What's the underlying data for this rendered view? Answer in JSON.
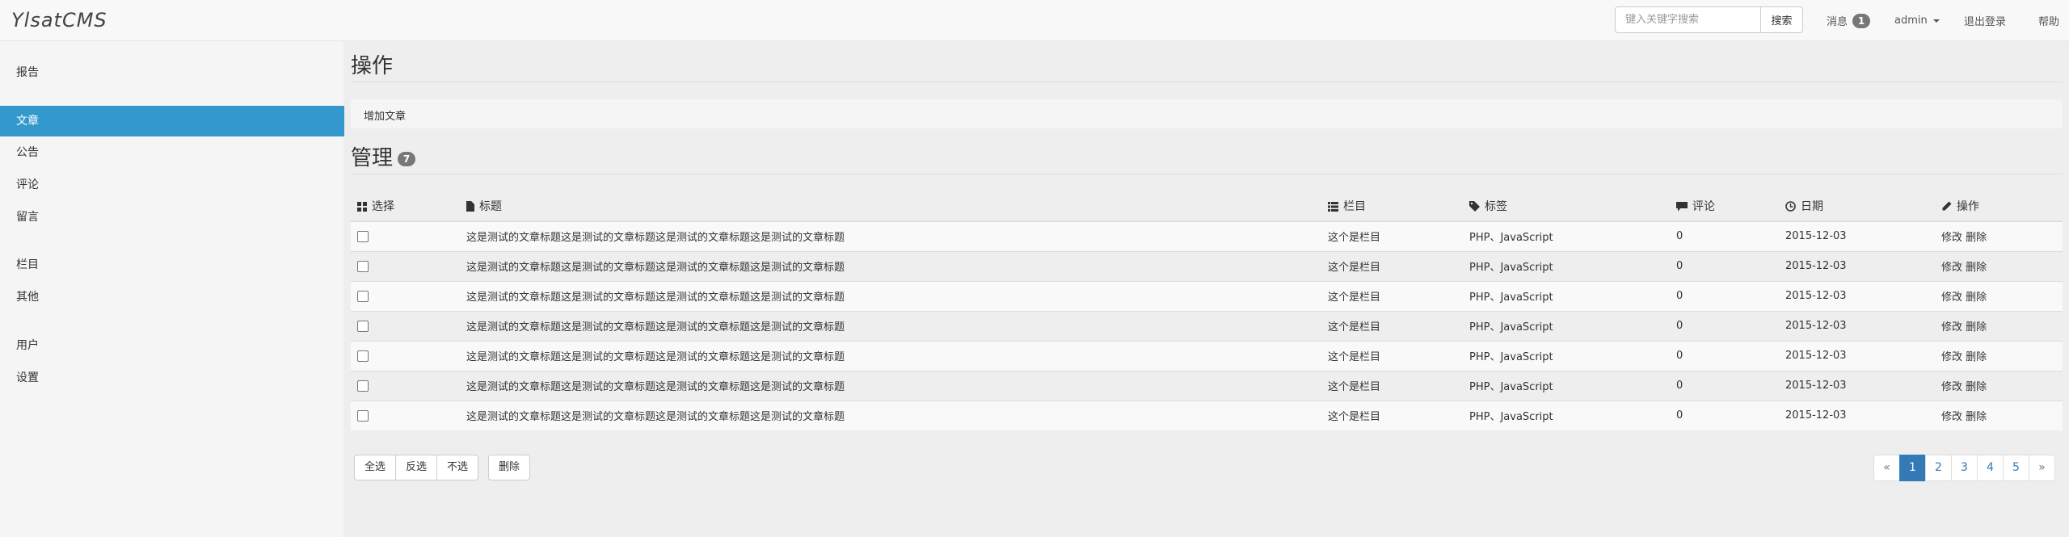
{
  "header": {
    "brand": "YlsatCMS",
    "search_placeholder": "键入关键字搜索",
    "search_button": "搜索",
    "messages_label": "消息",
    "messages_count": "1",
    "user": "admin",
    "logout": "退出登录",
    "help": "帮助"
  },
  "sidebar": {
    "items": [
      "报告",
      "文章",
      "公告",
      "评论",
      "留言",
      "栏目",
      "其他",
      "用户",
      "设置"
    ],
    "active": "文章"
  },
  "main": {
    "ops_title": "操作",
    "ops_link": "增加文章",
    "manage_title": "管理",
    "manage_count": "7",
    "columns": [
      "选择",
      "标题",
      "栏目",
      "标签",
      "评论",
      "日期",
      "操作"
    ],
    "rows": [
      {
        "title": "这是测试的文章标题这是测试的文章标题这是测试的文章标题这是测试的文章标题",
        "category": "这个是栏目",
        "tags": "PHP、JavaScript",
        "comments": "0",
        "date": "2015-12-03",
        "edit": "修改",
        "delete": "删除"
      },
      {
        "title": "这是测试的文章标题这是测试的文章标题这是测试的文章标题这是测试的文章标题",
        "category": "这个是栏目",
        "tags": "PHP、JavaScript",
        "comments": "0",
        "date": "2015-12-03",
        "edit": "修改",
        "delete": "删除"
      },
      {
        "title": "这是测试的文章标题这是测试的文章标题这是测试的文章标题这是测试的文章标题",
        "category": "这个是栏目",
        "tags": "PHP、JavaScript",
        "comments": "0",
        "date": "2015-12-03",
        "edit": "修改",
        "delete": "删除"
      },
      {
        "title": "这是测试的文章标题这是测试的文章标题这是测试的文章标题这是测试的文章标题",
        "category": "这个是栏目",
        "tags": "PHP、JavaScript",
        "comments": "0",
        "date": "2015-12-03",
        "edit": "修改",
        "delete": "删除"
      },
      {
        "title": "这是测试的文章标题这是测试的文章标题这是测试的文章标题这是测试的文章标题",
        "category": "这个是栏目",
        "tags": "PHP、JavaScript",
        "comments": "0",
        "date": "2015-12-03",
        "edit": "修改",
        "delete": "删除"
      },
      {
        "title": "这是测试的文章标题这是测试的文章标题这是测试的文章标题这是测试的文章标题",
        "category": "这个是栏目",
        "tags": "PHP、JavaScript",
        "comments": "0",
        "date": "2015-12-03",
        "edit": "修改",
        "delete": "删除"
      },
      {
        "title": "这是测试的文章标题这是测试的文章标题这是测试的文章标题这是测试的文章标题",
        "category": "这个是栏目",
        "tags": "PHP、JavaScript",
        "comments": "0",
        "date": "2015-12-03",
        "edit": "修改",
        "delete": "删除"
      }
    ],
    "bulk_buttons": [
      "全选",
      "反选",
      "不选"
    ],
    "delete_button": "删除",
    "pagination": [
      "«",
      "1",
      "2",
      "3",
      "4",
      "5",
      "»"
    ],
    "current_page": "1"
  }
}
